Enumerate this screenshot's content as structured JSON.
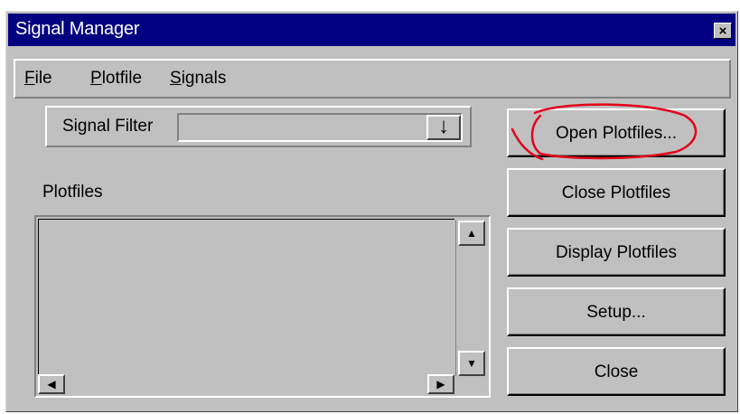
{
  "window": {
    "title": "Signal Manager",
    "close_glyph": "×"
  },
  "menu": {
    "items": [
      {
        "mnemonic": "F",
        "rest": "ile"
      },
      {
        "mnemonic": "P",
        "rest": "lotfile"
      },
      {
        "mnemonic": "S",
        "rest": "ignals"
      }
    ]
  },
  "filter": {
    "label": "Signal Filter",
    "value": "",
    "dropdown_icon": "↓"
  },
  "plotfiles": {
    "label": "Plotfiles",
    "items": []
  },
  "buttons": {
    "open": "Open Plotfiles...",
    "close_plotfiles": "Close Plotfiles",
    "display": "Display Plotfiles",
    "setup": "Setup...",
    "close": "Close"
  },
  "scroll_glyphs": {
    "up": "▲",
    "down": "▼",
    "left": "◀",
    "right": "▶"
  },
  "colors": {
    "titlebar": "#000080",
    "face": "#c0c0c0",
    "annotation": "#e3001b"
  }
}
